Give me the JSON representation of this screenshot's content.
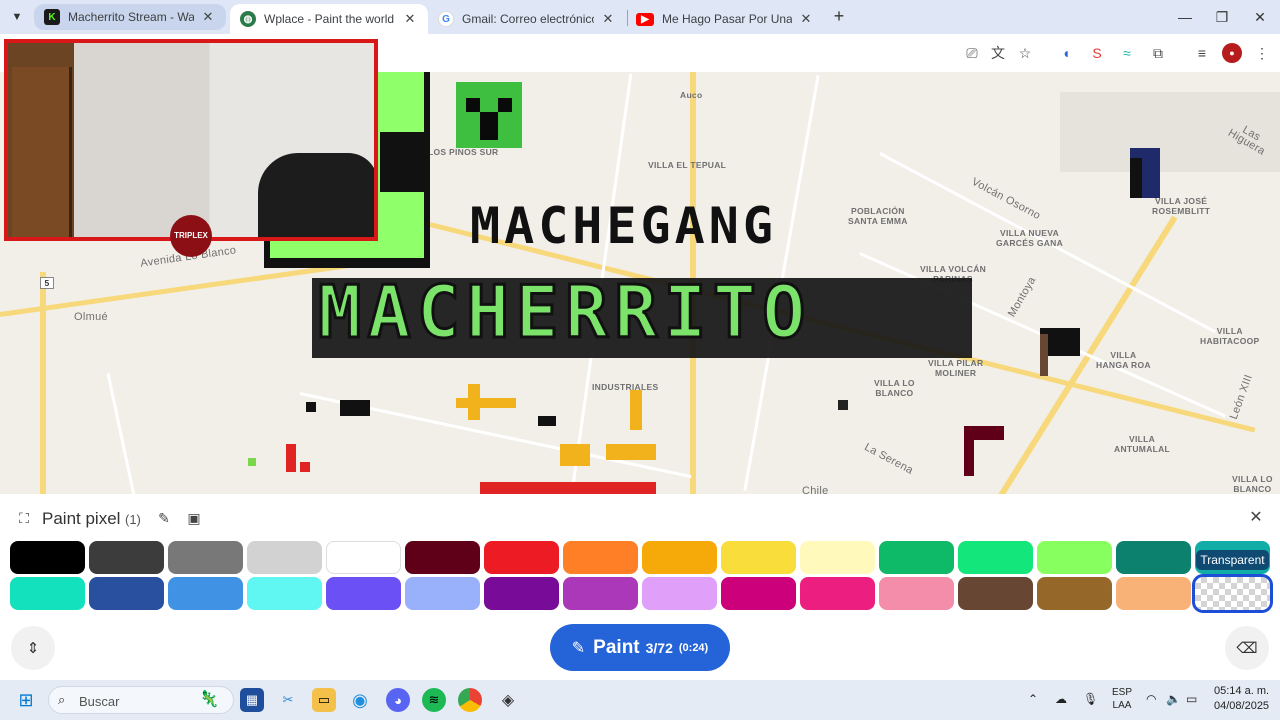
{
  "browser": {
    "tabs": [
      {
        "title": "Macherrito Stream - Watch Live",
        "favicon": "kick-icon",
        "active": false
      },
      {
        "title": "Wplace - Paint the world",
        "favicon": "globe-icon",
        "active": true
      },
      {
        "title": "Gmail: Correo electrónico gratuito",
        "favicon": "google-icon",
        "active": false
      },
      {
        "title": "Me Hago Pasar Por Una Figura",
        "favicon": "youtube-icon",
        "active": false
      }
    ]
  },
  "map": {
    "labels": {
      "los_pinos_sur": "LOS PINOS SUR",
      "auco": "Auco",
      "villa_el_tepual": "VILLA EL TEPUAL",
      "poblacion_santa_emma": "POBLACIÓN\nSANTA EMMA",
      "villa_nueva_garces_gana": "VILLA NUEVA\nGARCÉS GANA",
      "villa_jose_rosemblitt": "VILLA JOSÉ\nROSEMBLITT",
      "villa_volcan_parinas": "VILLA VOLCÁN\nPARINAS",
      "villa_pilar_moliner": "VILLA PILAR\nMOLINER",
      "villa_lo_blanco": "VILLA LO\nBLANCO",
      "villa_hanga_roa": "VILLA\nHANGA ROA",
      "villa_habitacoop": "VILLA\nHABITACOOP",
      "villa_antumalal": "VILLA\nANTUMALAL",
      "villa_lo_blanco_2": "VILLA LO\nBLANCO",
      "industriales": "INDUSTRIALES",
      "olmue": "Olmué",
      "avenida_lo_blanco": "Avenida Lo Blanco",
      "volcan_osorno": "Volcán Osorno",
      "la_serena": "La Serena",
      "chile": "Chile",
      "montoya": "Montoya",
      "las_higueras": "Las Higuera",
      "leon_xiii": "León XIII",
      "route_5": "5"
    },
    "pixel_art_title": "MACHEGANG",
    "pixel_art_subtitle": "MACHERRITO"
  },
  "panel": {
    "title": "Paint pixel",
    "count": "(1)",
    "tooltip": "Transparent",
    "palette_row1": [
      "#000000",
      "#3c3c3c",
      "#787878",
      "#d2d2d2",
      "#ffffff",
      "#600018",
      "#ed1c24",
      "#ff7f27",
      "#f6aa09",
      "#f9dd3b",
      "#fffabc",
      "#0eb968",
      "#13e67b",
      "#87ff5e",
      "#0c816e",
      "#10aea6"
    ],
    "palette_row2": [
      "#13e1be",
      "#28509e",
      "#4093e4",
      "#60f7f2",
      "#6b50f6",
      "#99b1fb",
      "#780c99",
      "#aa38b9",
      "#e09ff9",
      "#cb007a",
      "#ec1f80",
      "#f38da9",
      "#684634",
      "#95682a",
      "#f8b277",
      "transparent"
    ],
    "selected_index": 15,
    "paint_button": {
      "label": "Paint",
      "charges": "3/72",
      "timer": "(0:24)"
    }
  },
  "taskbar": {
    "search_placeholder": "Buscar",
    "language": "ESP",
    "layout": "LAA",
    "time": "05:14 a. m.",
    "date": "04/08/2025"
  }
}
